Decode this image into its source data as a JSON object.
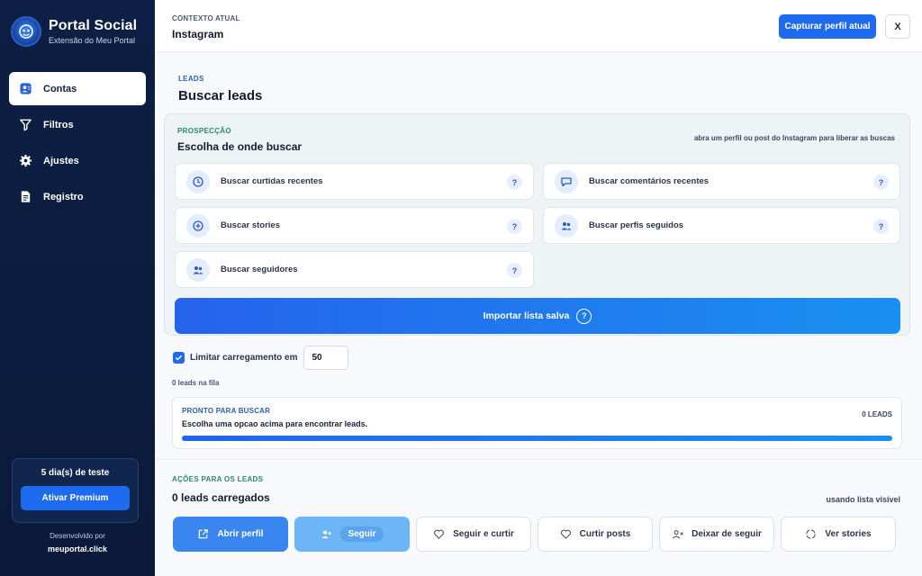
{
  "brand": {
    "title": "Portal Social",
    "subtitle": "Extensão do Meu Portal"
  },
  "sidebar": {
    "items": [
      {
        "label": "Contas",
        "icon": "contacts-icon",
        "active": true
      },
      {
        "label": "Filtros",
        "icon": "filter-icon",
        "active": false
      },
      {
        "label": "Ajustes",
        "icon": "gear-icon",
        "active": false
      },
      {
        "label": "Registro",
        "icon": "document-icon",
        "active": false
      }
    ],
    "trial": {
      "label": "5 dia(s) de teste",
      "button": "Ativar Premium"
    },
    "dev": {
      "label": "Desenvolvido por",
      "link": "meuportal.click"
    }
  },
  "topbar": {
    "context_label": "CONTEXTO ATUAL",
    "context_value": "Instagram",
    "capture_button": "Capturar perfil atual",
    "close_button": "X"
  },
  "section": {
    "eyebrow": "LEADS",
    "title": "Buscar leads"
  },
  "prospeccao": {
    "eyebrow": "PROSPECÇÃO",
    "title": "Escolha de onde buscar",
    "hint": "abra um perfil ou post do Instagram para liberar as buscas",
    "options": [
      {
        "label": "Buscar curtidas recentes",
        "icon": "history-icon",
        "help": "?"
      },
      {
        "label": "Buscar comentários recentes",
        "icon": "comment-icon",
        "help": "?"
      },
      {
        "label": "Buscar stories",
        "icon": "add-circle-icon",
        "help": "?"
      },
      {
        "label": "Buscar perfis seguidos",
        "icon": "people-icon",
        "help": "?"
      },
      {
        "label": "Buscar seguidores",
        "icon": "followers-icon",
        "help": "?"
      }
    ],
    "import_button": "Importar lista salva",
    "import_help": "?"
  },
  "limit": {
    "label": "Limitar carregamento em",
    "value": "50",
    "checked": true
  },
  "queue_text": "0 leads na fila",
  "status": {
    "eyebrow": "PRONTO PARA BUSCAR",
    "count": "0 LEADS",
    "message": "Escolha uma opcao acima para encontrar leads.",
    "progress": 1.0
  },
  "actions": {
    "eyebrow": "AÇÕES PARA OS LEADS",
    "title": "0 leads carregados",
    "hint": "usando lista visível",
    "buttons": [
      {
        "label": "Abrir perfil",
        "icon": "external-link-icon"
      },
      {
        "label": "Seguir",
        "icon": "add-user-icon"
      },
      {
        "label": "Seguir e curtir",
        "icon": "heart-icon"
      },
      {
        "label": "Curtir posts",
        "icon": "heart-icon"
      },
      {
        "label": "Deixar de seguir",
        "icon": "remove-user-icon"
      },
      {
        "label": "Ver stories",
        "icon": "circle-icon"
      }
    ]
  },
  "colors": {
    "accent": "#1f6bf0",
    "sidebar_bg": "#0d1f44",
    "green_eyebrow": "#2e8a63"
  }
}
